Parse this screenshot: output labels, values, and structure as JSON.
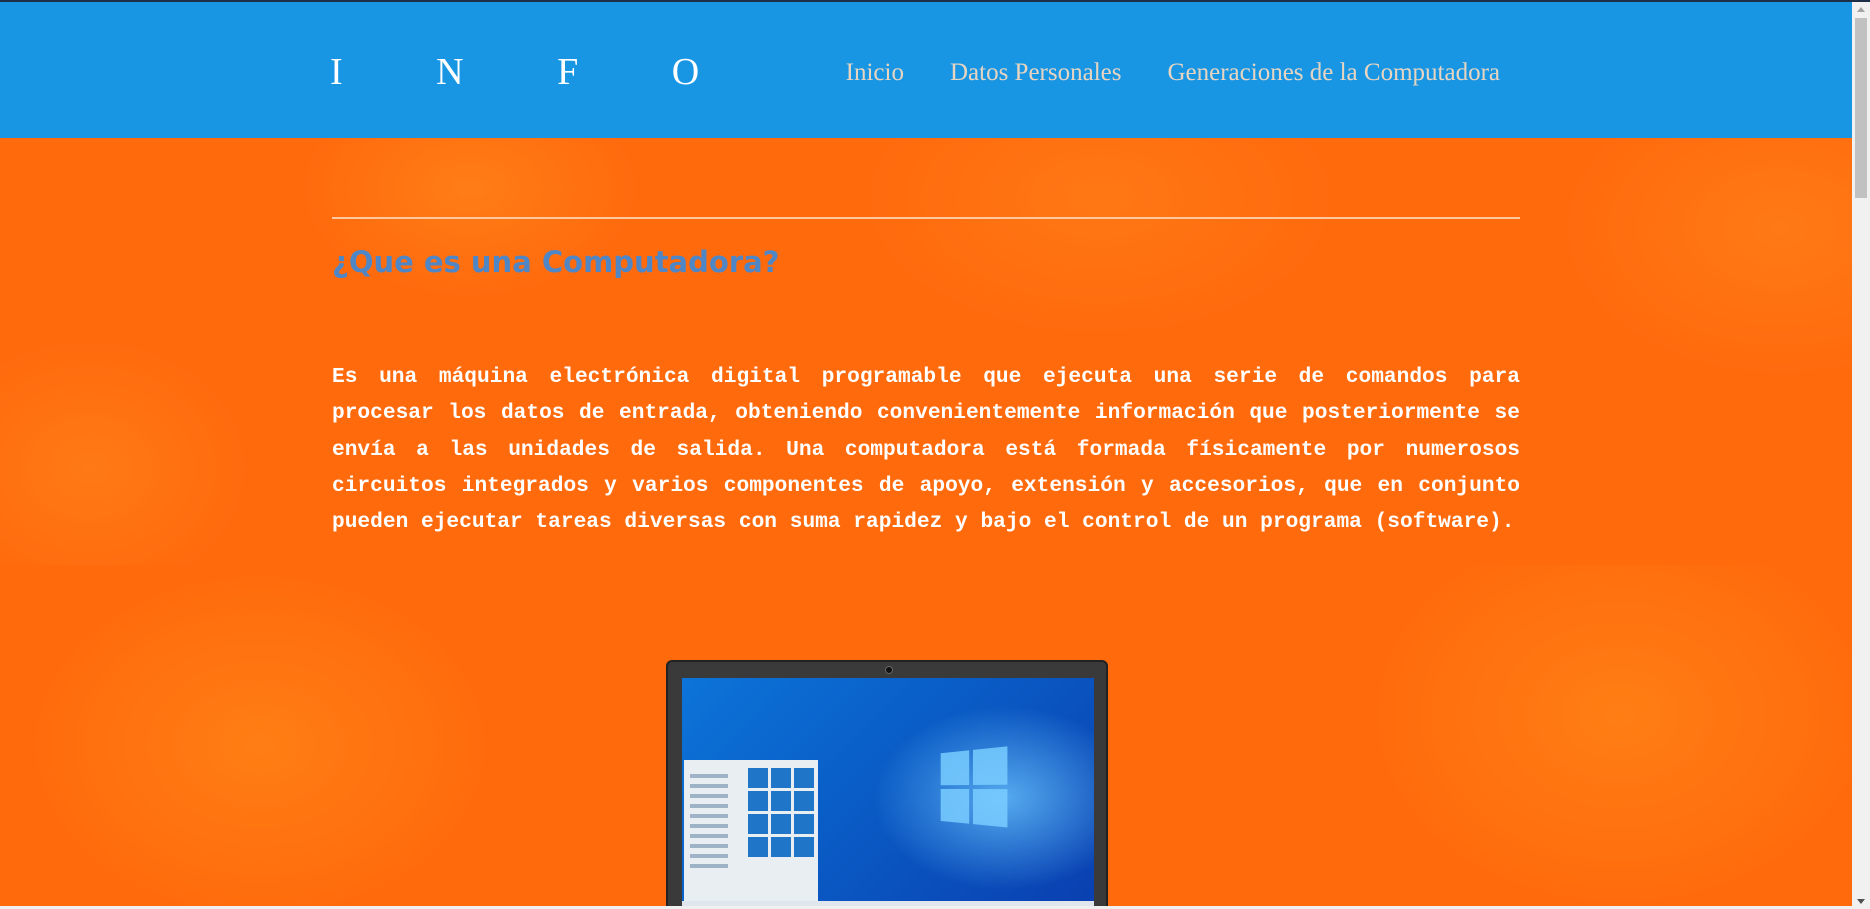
{
  "header": {
    "logo": "I N F O",
    "nav": [
      {
        "label": "Inicio"
      },
      {
        "label": "Datos Personales"
      },
      {
        "label": "Generaciones de la Computadora"
      }
    ]
  },
  "main": {
    "title": "¿Que es una Computadora?",
    "paragraph": "Es una máquina electrónica digital programable que ejecuta una serie de comandos para procesar los datos de entrada, obteniendo convenientemente información que posteriormente se envía a las unidades de salida. Una computadora está formada físicamente por numerosos circuitos integrados y varios componentes de apoyo, extensión y accesorios, que en conjunto pueden ejecutar tareas diversas con suma rapidez y bajo el control de un programa (software)."
  },
  "colors": {
    "header_bg": "#1896e4",
    "page_bg": "#ff6a0d",
    "title": "#4f86c6",
    "nav_text": "#e7d5c2"
  },
  "icons": {
    "image": "laptop-windows-screen-image"
  }
}
